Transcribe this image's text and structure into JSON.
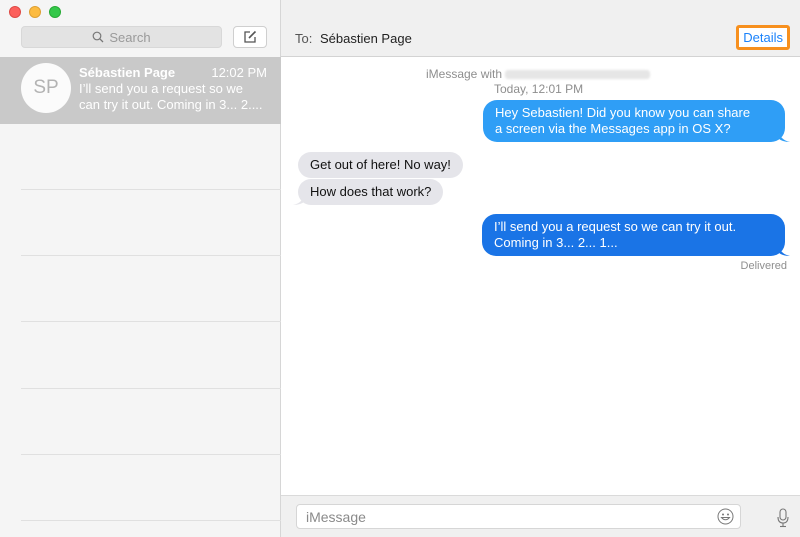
{
  "window": {
    "controls": [
      "close",
      "minimize",
      "maximize"
    ]
  },
  "sidebar": {
    "search_placeholder": "Search",
    "search_icon": "search-icon",
    "compose_icon": "compose-icon",
    "conversations": [
      {
        "initials": "SP",
        "name": "Sébastien Page",
        "time": "12:02 PM",
        "preview_line1": "I’ll send you a request so we",
        "preview_line2": "can try it out. Coming in 3... 2....",
        "selected": true
      }
    ]
  },
  "header": {
    "to_label": "To:",
    "recipient": "Sébastien Page",
    "details_label": "Details"
  },
  "chat": {
    "service_label": "iMessage with",
    "timestamp": "Today, 12:01 PM",
    "messages": [
      {
        "direction": "outgoing",
        "lines": [
          "Hey Sebastien! Did you know you can share",
          "a screen via the Messages app in OS X?"
        ]
      },
      {
        "direction": "incoming",
        "lines": [
          "Get out of here! No way!"
        ]
      },
      {
        "direction": "incoming",
        "lines": [
          "How does that work?"
        ]
      },
      {
        "direction": "outgoing",
        "lines": [
          "I’ll send you a request so we can try it out.",
          "Coming in 3... 2... 1..."
        ]
      }
    ],
    "status": "Delivered"
  },
  "composer": {
    "placeholder": "iMessage",
    "value": "",
    "emoji_icon": "emoji-icon",
    "mic_icon": "microphone-icon"
  },
  "colors": {
    "outgoing_bubble": "#2f9ef6",
    "outgoing_bubble_last": "#1a74e6",
    "incoming_bubble": "#e5e5ea",
    "link": "#1a82fb",
    "highlight": "#f7901e"
  }
}
